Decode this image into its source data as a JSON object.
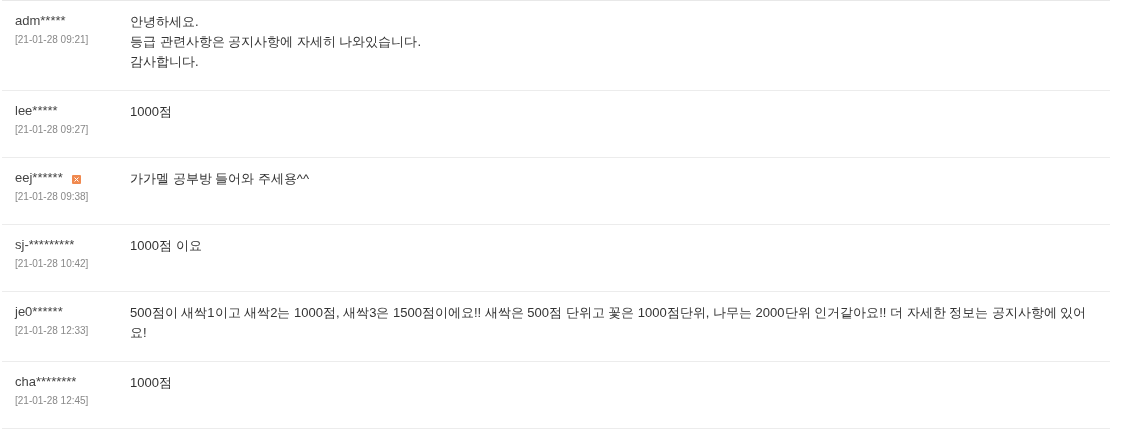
{
  "comments": [
    {
      "author": "adm*****",
      "date": "[21-01-28 09:21]",
      "delete_icon": false,
      "text": "안녕하세요.\n등급 관련사항은 공지사항에 자세히 나와있습니다.\n감사합니다."
    },
    {
      "author": "lee*****",
      "date": "[21-01-28 09:27]",
      "delete_icon": false,
      "text": "1000점"
    },
    {
      "author": "eej******",
      "date": "[21-01-28 09:38]",
      "delete_icon": true,
      "text": "가가멜 공부방 들어와 주세용^^"
    },
    {
      "author": "sj-*********",
      "date": "[21-01-28 10:42]",
      "delete_icon": false,
      "text": "1000점 이요"
    },
    {
      "author": "je0******",
      "date": "[21-01-28 12:33]",
      "delete_icon": false,
      "text": "500점이 새싹1이고 새싹2는 1000점, 새싹3은 1500점이에요!! 새싹은 500점 단위고 꽃은 1000점단위, 나무는 2000단위 인거같아요!! 더 자세한 정보는 공지사항에 있어요!"
    },
    {
      "author": "cha********",
      "date": "[21-01-28 12:45]",
      "delete_icon": false,
      "text": "1000점"
    }
  ]
}
